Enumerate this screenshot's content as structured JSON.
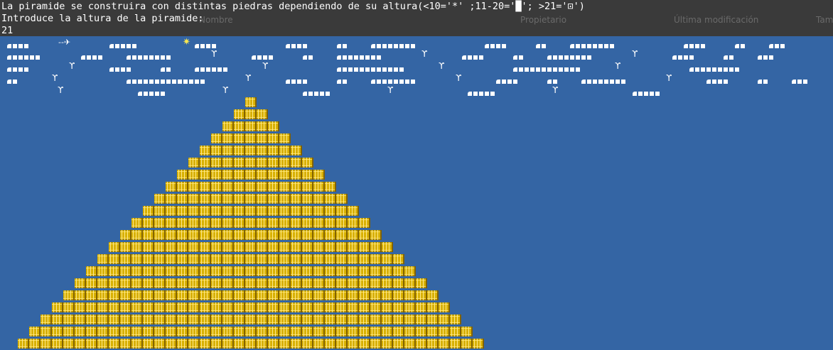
{
  "terminal": {
    "line1": "La piramide se construira con distintas piedras dependiendo de su altura(<10='*' ;11-20='█'; >21='⊡')",
    "line2": "Introduce la altura de la piramide:",
    "line3": "21"
  },
  "background_menu": {
    "nombre": "Nombre",
    "propietario": "Propietario",
    "ultima_modificacion": "Última modificación",
    "tamano": "Tam"
  },
  "pyramid": {
    "rows": 21
  },
  "colors": {
    "sky": "#3465a4",
    "header": "#3a3a3a",
    "stone": "#d8b000",
    "sun": "#fce94f"
  },
  "icons": [
    "cloud-icon",
    "bird-icon",
    "sun-icon",
    "plane-icon"
  ]
}
